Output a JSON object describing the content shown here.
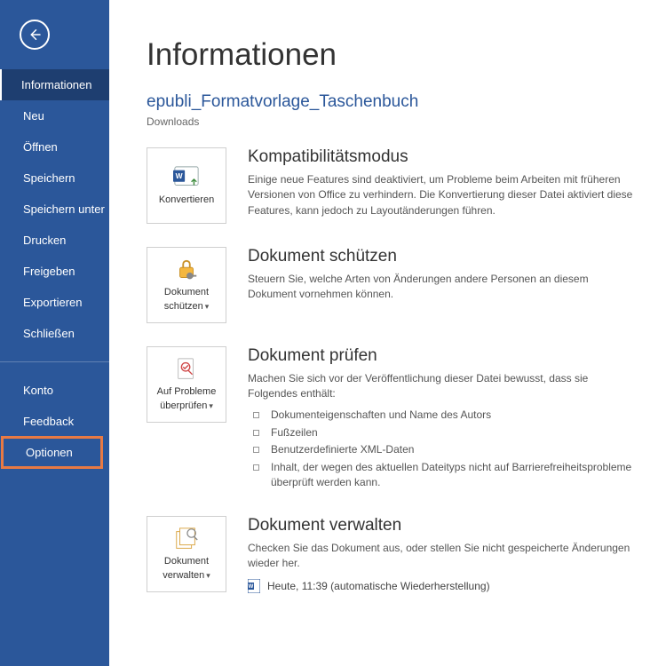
{
  "sidebar": {
    "items": [
      {
        "label": "Informationen",
        "active": true
      },
      {
        "label": "Neu"
      },
      {
        "label": "Öffnen"
      },
      {
        "label": "Speichern"
      },
      {
        "label": "Speichern unter"
      },
      {
        "label": "Drucken"
      },
      {
        "label": "Freigeben"
      },
      {
        "label": "Exportieren"
      },
      {
        "label": "Schließen"
      }
    ],
    "footer_items": [
      {
        "label": "Konto"
      },
      {
        "label": "Feedback"
      },
      {
        "label": "Optionen",
        "highlighted": true
      }
    ]
  },
  "page": {
    "title": "Informationen",
    "doc_title": "epubli_Formatvorlage_Taschenbuch",
    "doc_location": "Downloads"
  },
  "sections": {
    "compat": {
      "tile_label": "Konvertieren",
      "heading": "Kompatibilitätsmodus",
      "desc": "Einige neue Features sind deaktiviert, um Probleme beim Arbeiten mit früheren Versionen von Office zu verhindern. Die Konvertierung dieser Datei aktiviert diese Features, kann jedoch zu Layoutänderungen führen."
    },
    "protect": {
      "tile_label_line1": "Dokument",
      "tile_label_line2": "schützen",
      "heading": "Dokument schützen",
      "desc": "Steuern Sie, welche Arten von Änderungen andere Personen an diesem Dokument vornehmen können."
    },
    "inspect": {
      "tile_label_line1": "Auf Probleme",
      "tile_label_line2": "überprüfen",
      "heading": "Dokument prüfen",
      "desc": "Machen Sie sich vor der Veröffentlichung dieser Datei bewusst, dass sie Folgendes enthält:",
      "bullets": [
        "Dokumenteigenschaften und Name des Autors",
        "Fußzeilen",
        "Benutzerdefinierte XML-Daten",
        "Inhalt, der wegen des aktuellen Dateityps nicht auf Barrierefreiheitsprobleme überprüft werden kann."
      ]
    },
    "manage": {
      "tile_label_line1": "Dokument",
      "tile_label_line2": "verwalten",
      "heading": "Dokument verwalten",
      "desc": "Checken Sie das Dokument aus, oder stellen Sie nicht gespeicherte Änderungen wieder her.",
      "recovery": "Heute, 11:39 (automatische Wiederherstellung)"
    }
  }
}
